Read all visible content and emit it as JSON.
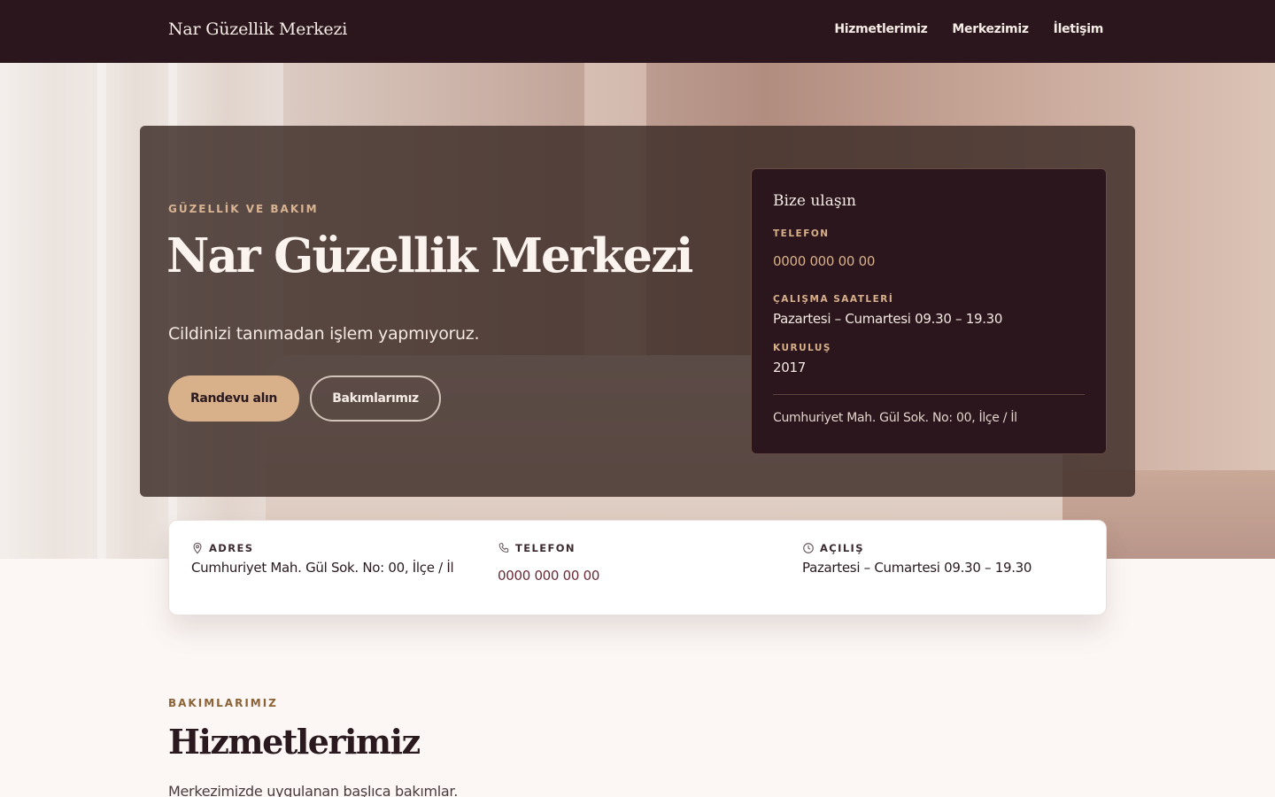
{
  "header": {
    "brand": "Nar Güzellik Merkezi",
    "nav": [
      "Hizmetlerimiz",
      "Merkezimiz",
      "İletişim"
    ]
  },
  "hero": {
    "eyebrow": "GÜZELLİK VE BAKIM",
    "title": "Nar Güzellik Merkezi",
    "subtitle": "Cildinizi tanımadan işlem yapmıyoruz.",
    "primary_button": "Randevu alın",
    "secondary_button": "Bakımlarımız"
  },
  "contact_card": {
    "title": "Bize ulaşın",
    "phone_label": "TELEFON",
    "phone": "0000 000 00 00",
    "hours_label": "ÇALIŞMA SAATLERİ",
    "hours": "Pazartesi – Cumartesi 09.30 – 19.30",
    "founded_label": "KURULUŞ",
    "founded": "2017",
    "address": "Cumhuriyet Mah. Gül Sok. No: 00, İlçe / İl"
  },
  "info_strip": {
    "address_label": "ADRES",
    "address": "Cumhuriyet Mah. Gül Sok. No: 00, İlçe / İl",
    "phone_label": "TELEFON",
    "phone": "0000 000 00 00",
    "opening_label": "AÇILIŞ",
    "opening": "Pazartesi – Cumartesi 09.30 – 19.30"
  },
  "services": {
    "eyebrow": "BAKIMLARIMIZ",
    "title": "Hizmetlerimiz",
    "description": "Merkezimizde uygulanan başlıca bakımlar."
  },
  "colors": {
    "header_bg": "#2a161c",
    "accent": "#d8b08a",
    "page_bg": "#fcf7f5"
  }
}
